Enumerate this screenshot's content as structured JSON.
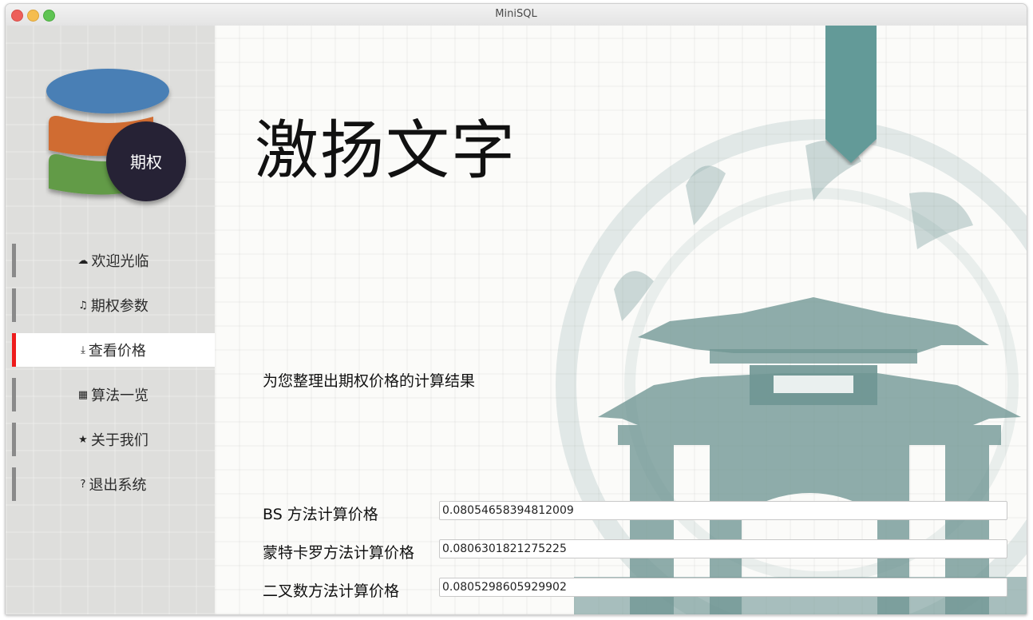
{
  "window": {
    "title": "MiniSQL"
  },
  "logo": {
    "badge_text": "期权",
    "colors": {
      "top": "#4a7fb5",
      "middle": "#d06c30",
      "bottom": "#629b47",
      "badge": "#262335"
    }
  },
  "sidebar": {
    "items": [
      {
        "icon": "cloud-icon",
        "glyph": "☁",
        "label": "欢迎光临",
        "active": false
      },
      {
        "icon": "music-note-icon",
        "glyph": "♫",
        "label": "期权参数",
        "active": false
      },
      {
        "icon": "download-icon",
        "glyph": "⤓",
        "label": "查看价格",
        "active": true
      },
      {
        "icon": "film-icon",
        "glyph": "▦",
        "label": "算法一览",
        "active": false
      },
      {
        "icon": "star-icon",
        "glyph": "★",
        "label": "关于我们",
        "active": false
      },
      {
        "icon": "question-icon",
        "glyph": "?",
        "label": "退出系统",
        "active": false
      }
    ],
    "active_color": "#ee1c1c"
  },
  "main": {
    "heading": "激扬文字",
    "subtitle": "为您整理出期权价格的计算结果",
    "results": [
      {
        "label": "BS 方法计算价格",
        "value": "0.08054658394812009"
      },
      {
        "label": "蒙特卡罗方法计算价格",
        "value": "0.0806301821275225"
      },
      {
        "label": "二叉数方法计算价格",
        "value": "0.0805298605929902"
      }
    ]
  },
  "accent": {
    "ribbon": "#639a98",
    "watermark": "#6f9694"
  }
}
